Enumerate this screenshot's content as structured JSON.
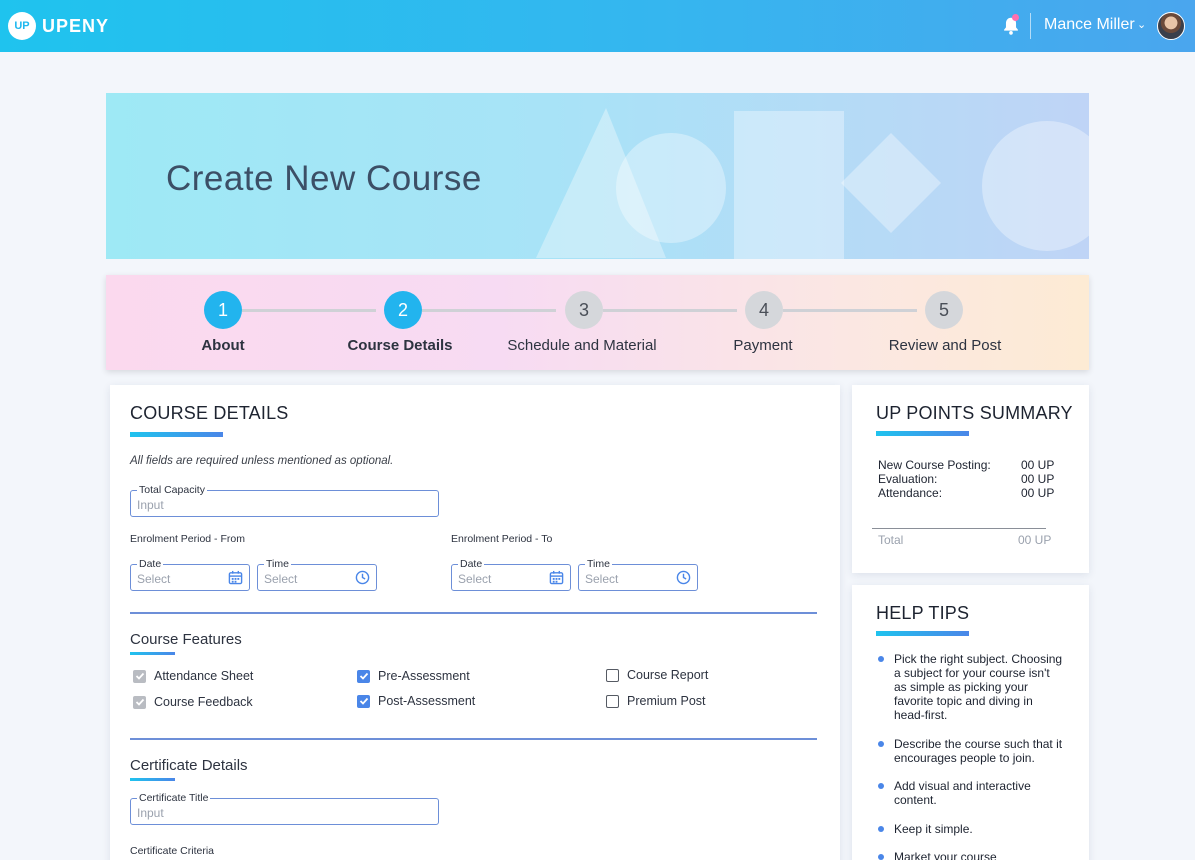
{
  "app": {
    "logo_text": "UPENY",
    "logo_mark": "UP"
  },
  "header": {
    "username": "Mance Miller",
    "chevron": "⌄",
    "icons": [
      "bell-icon",
      "avatar"
    ]
  },
  "banner": {
    "title": "Create New Course"
  },
  "steps": [
    {
      "number": "1",
      "label": "About",
      "state": "active"
    },
    {
      "number": "2",
      "label": "Course Details",
      "state": "active"
    },
    {
      "number": "3",
      "label": "Schedule and Material",
      "state": "idle"
    },
    {
      "number": "4",
      "label": "Payment",
      "state": "idle"
    },
    {
      "number": "5",
      "label": "Review and Post",
      "state": "idle"
    }
  ],
  "course_details": {
    "title": "COURSE DETAILS",
    "note": "All fields are required unless mentioned as optional.",
    "total_capacity": {
      "label": "Total Capacity",
      "placeholder": "Input"
    },
    "enrolment_from": {
      "label": "Enrolment Period - From",
      "date": {
        "label": "Date",
        "placeholder": "Select"
      },
      "time": {
        "label": "Time",
        "placeholder": "Select"
      }
    },
    "enrolment_to": {
      "label": "Enrolment Period - To",
      "date": {
        "label": "Date",
        "placeholder": "Select"
      },
      "time": {
        "label": "Time",
        "placeholder": "Select"
      }
    },
    "features": {
      "title": "Course Features",
      "items": [
        {
          "label": "Attendance Sheet",
          "checked": true,
          "disabled": true
        },
        {
          "label": "Course Feedback",
          "checked": true,
          "disabled": true
        },
        {
          "label": "Pre-Assessment",
          "checked": true,
          "disabled": false
        },
        {
          "label": "Post-Assessment",
          "checked": true,
          "disabled": false
        },
        {
          "label": "Course Report",
          "checked": false,
          "disabled": false
        },
        {
          "label": "Premium Post",
          "checked": false,
          "disabled": false
        }
      ]
    },
    "certificate": {
      "title": "Certificate Details",
      "cert_title": {
        "label": "Certificate Title",
        "placeholder": "Input"
      },
      "criteria_label": "Certificate Criteria"
    }
  },
  "up_points": {
    "title": "UP POINTS SUMMARY",
    "rows": [
      {
        "label": "New Course Posting:",
        "value": "00 UP"
      },
      {
        "label": "Evaluation:",
        "value": "00 UP"
      },
      {
        "label": "Attendance:",
        "value": "00 UP"
      }
    ],
    "total_label": "Total",
    "total_value": "00 UP"
  },
  "help_tips": {
    "title": "HELP TIPS",
    "tips": [
      "Pick the right subject. Choosing a subject for your course isn't as simple as picking your favorite topic and diving in head-first.",
      "Describe the course such that it encourages people to join.",
      "Add visual and interactive content.",
      "Keep it simple.",
      "Market your course"
    ]
  },
  "colors": {
    "accent": "#22b4ee",
    "field_border": "#6d8fd8",
    "checkbox_blue": "#4a86e8"
  }
}
